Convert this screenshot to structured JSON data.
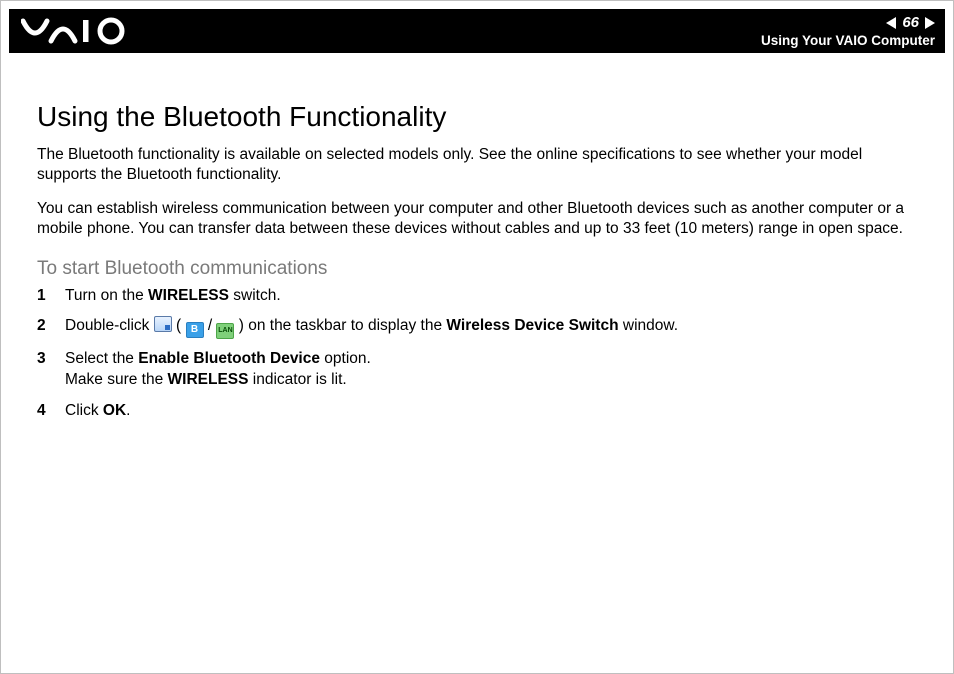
{
  "header": {
    "page_number": "66",
    "chapter": "Using Your VAIO Computer"
  },
  "title": "Using the Bluetooth Functionality",
  "paragraphs": {
    "p1": "The Bluetooth functionality is available on selected models only. See the online specifications to see whether your model supports the Bluetooth functionality.",
    "p2": "You can establish wireless communication between your computer and other Bluetooth devices such as another computer or a mobile phone. You can transfer data between these devices without cables and up to 33 feet (10 meters) range in open space."
  },
  "subhead": "To start Bluetooth communications",
  "steps": {
    "s1_a": "Turn on the ",
    "s1_b": "WIRELESS",
    "s1_c": " switch.",
    "s2_a": "Double-click ",
    "s2_b": " ( ",
    "s2_c": " / ",
    "s2_d": " ) on the taskbar to display the ",
    "s2_e": "Wireless Device Switch",
    "s2_f": " window.",
    "s3_a": "Select the ",
    "s3_b": "Enable Bluetooth Device",
    "s3_c": " option.",
    "s3_d": "Make sure the ",
    "s3_e": "WIRELESS",
    "s3_f": " indicator is lit.",
    "s4_a": "Click ",
    "s4_b": "OK",
    "s4_c": "."
  },
  "icons": {
    "bt_glyph": "B",
    "lan_glyph": "LAN"
  }
}
